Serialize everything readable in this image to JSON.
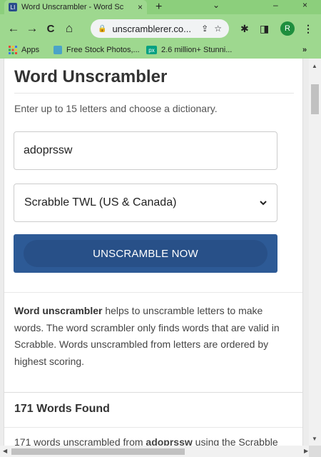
{
  "browser": {
    "tab": {
      "favicon_text": "LI",
      "title": "Word Unscrambler - Word Sc",
      "close": "×"
    },
    "new_tab": "+",
    "window_controls": {
      "chevron": "⌄",
      "minimize": "–",
      "close": "×"
    },
    "nav": {
      "back": "←",
      "forward": "→",
      "reload": "C",
      "home": "⌂"
    },
    "address": {
      "lock": "🔒",
      "url": "unscramblerer.co...",
      "share": "⇪",
      "bookmark": "☆"
    },
    "toolbar_icons": {
      "extensions": "✱",
      "sidepanel": "◨",
      "profile": "R",
      "menu": "⋮"
    },
    "bookmarks": [
      {
        "label": "Apps",
        "icon": "apps-grid-icon"
      },
      {
        "label": "Free Stock Photos,...",
        "icon": "stock-photos-icon"
      },
      {
        "label": "2.6 million+ Stunni...",
        "icon": "pexels-icon",
        "icon_text": "px"
      }
    ],
    "bookmarks_overflow": "»"
  },
  "page": {
    "title": "Word Unscrambler",
    "subtitle": "Enter up to 15 letters and choose a dictionary.",
    "letters_value": "adoprssw",
    "dictionary_selected": "Scrabble TWL (US & Canada)",
    "button_label": "UNSCRAMBLE NOW",
    "description": {
      "bold_lead": "Word unscrambler",
      "rest": " helps to unscramble letters to make words. The word scrambler only finds words that are valid in Scrabble. Words unscrambled from letters are ordered by highest scoring."
    },
    "found": {
      "title": "171 Words Found",
      "desc_prefix": "171 words unscrambled from ",
      "desc_bold": "adoprssw",
      "desc_suffix": " using the Scrabble"
    }
  },
  "colors": {
    "chrome_green": "#9ed88f",
    "button_blue": "#2d5a96",
    "profile_green": "#1e8e3e"
  }
}
